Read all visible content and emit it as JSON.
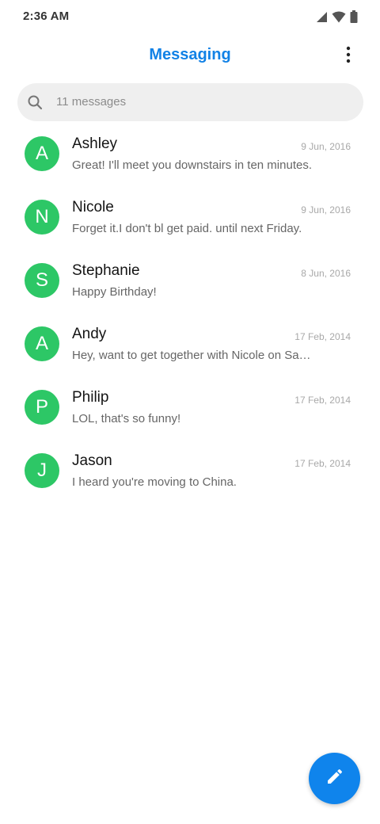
{
  "status_bar": {
    "time": "2:36 AM",
    "icons": [
      "signal-icon",
      "wifi-icon",
      "battery-icon"
    ]
  },
  "header": {
    "title": "Messaging",
    "more_icon": "more-vertical-icon"
  },
  "search": {
    "placeholder": "11 messages",
    "icon": "search-icon"
  },
  "conversations": [
    {
      "initial": "A",
      "name": "Ashley",
      "date": "9 Jun, 2016",
      "preview": "Great! I'll meet you downstairs in ten minutes."
    },
    {
      "initial": "N",
      "name": "Nicole",
      "date": "9 Jun, 2016",
      "preview": "Forget it.I don't bl get paid. until next Friday."
    },
    {
      "initial": "S",
      "name": "Stephanie",
      "date": "8 Jun, 2016",
      "preview": "Happy Birthday!"
    },
    {
      "initial": "A",
      "name": "Andy",
      "date": "17 Feb, 2014",
      "preview": "Hey, want to get together with Nicole on Saturday?"
    },
    {
      "initial": "P",
      "name": "Philip",
      "date": "17 Feb, 2014",
      "preview": "LOL, that's so funny!"
    },
    {
      "initial": "J",
      "name": "Jason",
      "date": "17 Feb, 2014",
      "preview": "I heard you're moving to China."
    }
  ],
  "fab": {
    "icon": "pencil-icon"
  },
  "colors": {
    "accent": "#1282e6",
    "avatar": "#2dc766",
    "fab": "#0f84ec",
    "search_bg": "#efefef"
  }
}
